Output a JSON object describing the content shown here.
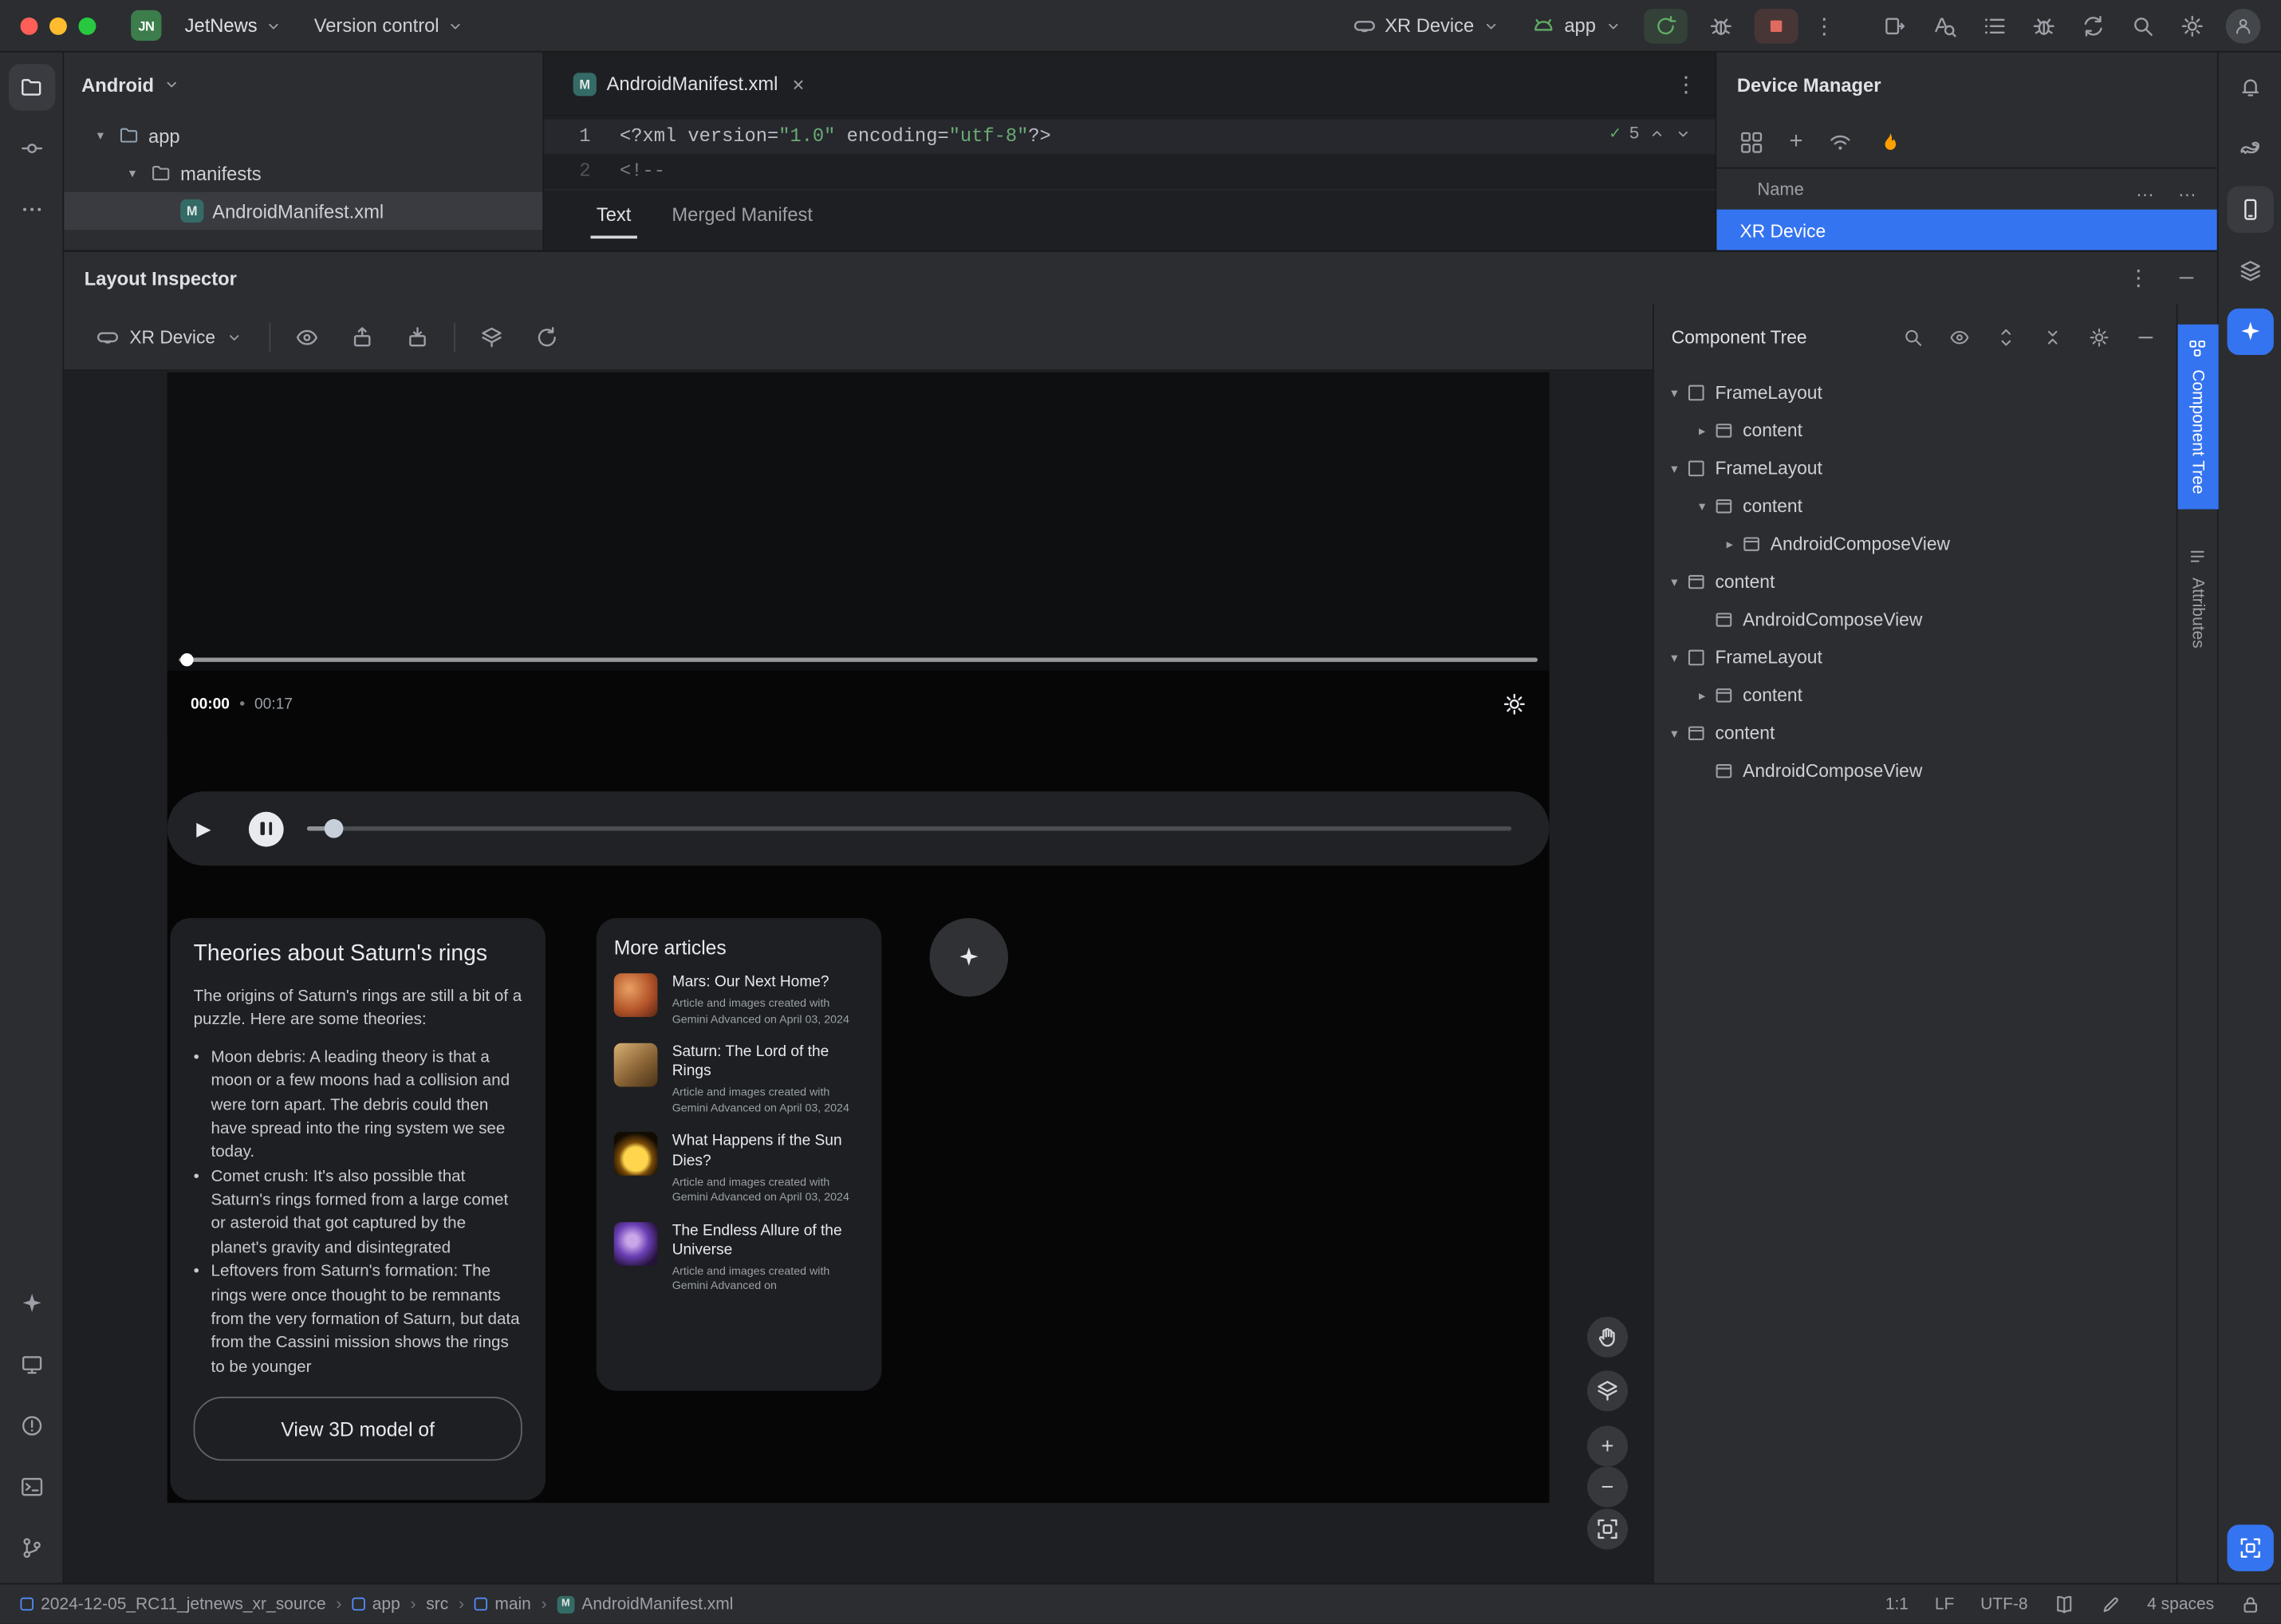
{
  "colors": {
    "accent_blue": "#3574f0",
    "run_green": "#5fad65",
    "stop_red": "#e06a60",
    "string_green": "#6aab73",
    "firebase_orange": "#ffa000",
    "selected_row": "#393b40"
  },
  "titlebar": {
    "app_badge": "JN",
    "project": "JetNews",
    "vcs": "Version control",
    "device": "XR Device",
    "run_config": "app"
  },
  "project_panel": {
    "title": "Android",
    "items": [
      {
        "label": "app"
      },
      {
        "label": "manifests"
      },
      {
        "label": "AndroidManifest.xml"
      }
    ]
  },
  "editor": {
    "tab_title": "AndroidManifest.xml",
    "inspection_ok_count": "5",
    "views": [
      {
        "label": "Text"
      },
      {
        "label": "Merged Manifest"
      }
    ],
    "lines": [
      {
        "num": "1",
        "active": true,
        "tokens": [
          {
            "t": "<?xml version=",
            "s": "p"
          },
          {
            "t": "\"1.0\"",
            "s": "str"
          },
          {
            "t": " encoding=",
            "s": "p"
          },
          {
            "t": "\"utf-8\"",
            "s": "str"
          },
          {
            "t": "?>",
            "s": "p"
          }
        ]
      },
      {
        "num": "2",
        "active": false,
        "tokens": [
          {
            "t": "<!--",
            "s": "c"
          }
        ]
      }
    ]
  },
  "device_manager": {
    "title": "Device Manager",
    "name_column": "Name",
    "rows": [
      {
        "name": "XR Device"
      }
    ]
  },
  "layout_inspector": {
    "title": "Layout Inspector",
    "process": "XR Device",
    "side_tabs": [
      {
        "label": "Component Tree"
      },
      {
        "label": "Attributes"
      }
    ],
    "component_tree": {
      "title": "Component Tree",
      "rows": [
        {
          "d": 0,
          "c": "down",
          "i": "frame",
          "label": "FrameLayout"
        },
        {
          "d": 1,
          "c": "right",
          "i": "view",
          "label": "content"
        },
        {
          "d": 0,
          "c": "down",
          "i": "frame",
          "label": "FrameLayout"
        },
        {
          "d": 1,
          "c": "down",
          "i": "view",
          "label": "content"
        },
        {
          "d": 2,
          "c": "right",
          "i": "view",
          "label": "AndroidComposeView"
        },
        {
          "d": 0,
          "c": "down",
          "i": "view",
          "label": "content"
        },
        {
          "d": 1,
          "c": "none",
          "i": "view",
          "label": "AndroidComposeView"
        },
        {
          "d": 0,
          "c": "down",
          "i": "frame",
          "label": "FrameLayout"
        },
        {
          "d": 1,
          "c": "right",
          "i": "view",
          "label": "content"
        },
        {
          "d": 0,
          "c": "down",
          "i": "view",
          "label": "content"
        },
        {
          "d": 1,
          "c": "none",
          "i": "view",
          "label": "AndroidComposeView"
        }
      ]
    }
  },
  "app_screen": {
    "video": {
      "current_time": "00:00",
      "duration": "00:17"
    },
    "theories_card": {
      "title": "Theories about Saturn's rings",
      "intro": "The origins of Saturn's rings are still a bit of a puzzle. Here are some theories:",
      "bullets": [
        "Moon debris: A leading theory is that a moon or a few moons had a collision and were torn apart. The debris could then have spread into the ring system we see today.",
        "Comet crush: It's also possible that Saturn's rings formed from a large comet or asteroid that got captured by the planet's gravity and disintegrated",
        "Leftovers from Saturn's formation: The rings were once thought to be remnants from the very formation of Saturn, but data from the Cassini mission shows the rings to be younger"
      ],
      "cta": "View 3D model of"
    },
    "articles_card": {
      "title": "More articles",
      "items": [
        {
          "title": "Mars: Our Next Home?",
          "caption": "Article and images created with Gemini Advanced on April 03, 2024",
          "thumb": "mars"
        },
        {
          "title": "Saturn: The Lord of the Rings",
          "caption": "Article and images created with Gemini Advanced on April 03, 2024",
          "thumb": "saturn"
        },
        {
          "title": "What Happens if the Sun Dies?",
          "caption": "Article and images created with Gemini Advanced on April 03, 2024",
          "thumb": "sun"
        },
        {
          "title": "The Endless Allure of the Universe",
          "caption": "Article and images created with Gemini Advanced on",
          "thumb": "galaxy"
        }
      ]
    }
  },
  "status_bar": {
    "breadcrumbs": [
      {
        "label": "2024-12-05_RC11_jetnews_xr_source",
        "icon": "module"
      },
      {
        "label": "app",
        "icon": "module"
      },
      {
        "label": "src",
        "icon": ""
      },
      {
        "label": "main",
        "icon": "module"
      },
      {
        "label": "AndroidManifest.xml",
        "icon": "manifest"
      }
    ],
    "cursor": "1:1",
    "line_ending": "LF",
    "encoding": "UTF-8",
    "indent": "4 spaces"
  }
}
